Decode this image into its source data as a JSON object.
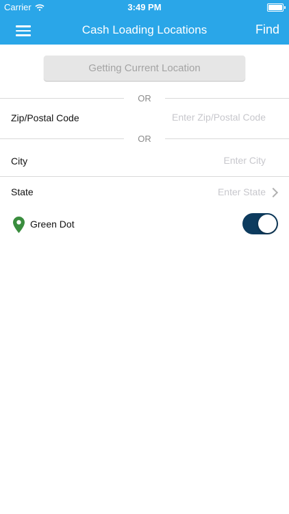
{
  "status_bar": {
    "carrier": "Carrier",
    "time": "3:49 PM"
  },
  "nav": {
    "title": "Cash Loading Locations",
    "find_label": "Find"
  },
  "current_location_button": {
    "label": "Getting Current Location"
  },
  "separators": {
    "or_1": "OR",
    "or_2": "OR"
  },
  "zip": {
    "label": "Zip/Postal Code",
    "value": "",
    "placeholder": "Enter Zip/Postal Code"
  },
  "city": {
    "label": "City",
    "value": "",
    "placeholder": "Enter City"
  },
  "state": {
    "label": "State",
    "placeholder": "Enter State"
  },
  "green_dot": {
    "label": "Green Dot",
    "toggle_on": true
  },
  "colors": {
    "header": "#2aa6e8",
    "toggle_on": "#0d3b5e",
    "pin": "#3a8d3e"
  }
}
